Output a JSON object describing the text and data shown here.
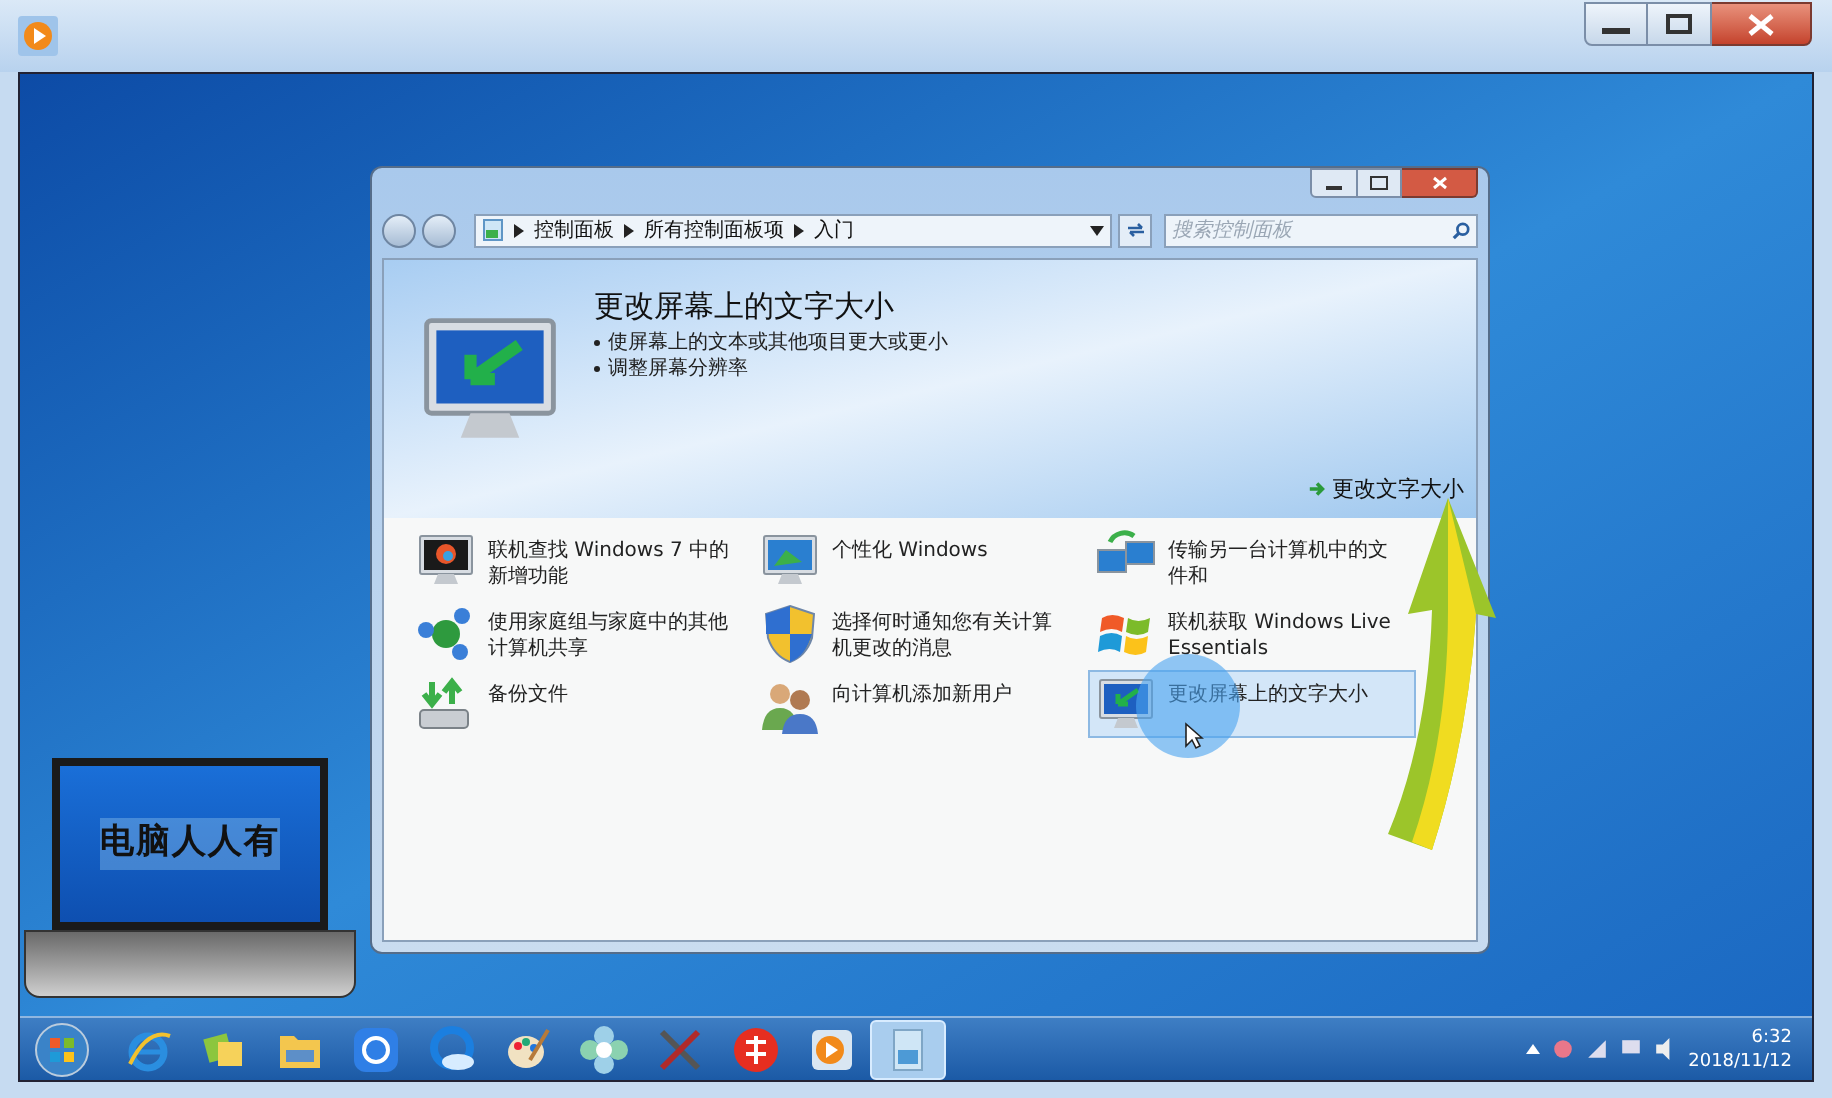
{
  "control_panel": {
    "breadcrumb": [
      "控制面板",
      "所有控制面板项",
      "入门"
    ],
    "search": {
      "placeholder": "搜索控制面板"
    },
    "header": {
      "title": "更改屏幕上的文字大小",
      "bullets": [
        "使屏幕上的文本或其他项目更大或更小",
        "调整屏幕分辨率"
      ],
      "link": "更改文字大小"
    },
    "items": [
      {
        "label": "联机查找 Windows 7 中的新增功能",
        "selected": false
      },
      {
        "label": "个性化 Windows",
        "selected": false
      },
      {
        "label": "传输另一台计算机中的文件和",
        "selected": false
      },
      {
        "label": "使用家庭组与家庭中的其他计算机共享",
        "selected": false
      },
      {
        "label": "选择何时通知您有关计算机更改的消息",
        "selected": false
      },
      {
        "label": "联机获取 Windows Live Essentials",
        "selected": false
      },
      {
        "label": "备份文件",
        "selected": false
      },
      {
        "label": "向计算机添加新用户",
        "selected": false
      },
      {
        "label": "更改屏幕上的文字大小",
        "selected": true
      }
    ]
  },
  "logo": {
    "text": "电脑人人有"
  },
  "taskbar": {
    "apps": [
      {
        "selected": false
      },
      {
        "selected": false
      },
      {
        "selected": false
      },
      {
        "selected": false
      },
      {
        "selected": false
      },
      {
        "selected": false
      },
      {
        "selected": false
      },
      {
        "selected": false
      },
      {
        "selected": false
      },
      {
        "selected": false
      },
      {
        "selected": true
      }
    ],
    "clock": {
      "time": "6:32",
      "date": "2018/11/12"
    }
  }
}
